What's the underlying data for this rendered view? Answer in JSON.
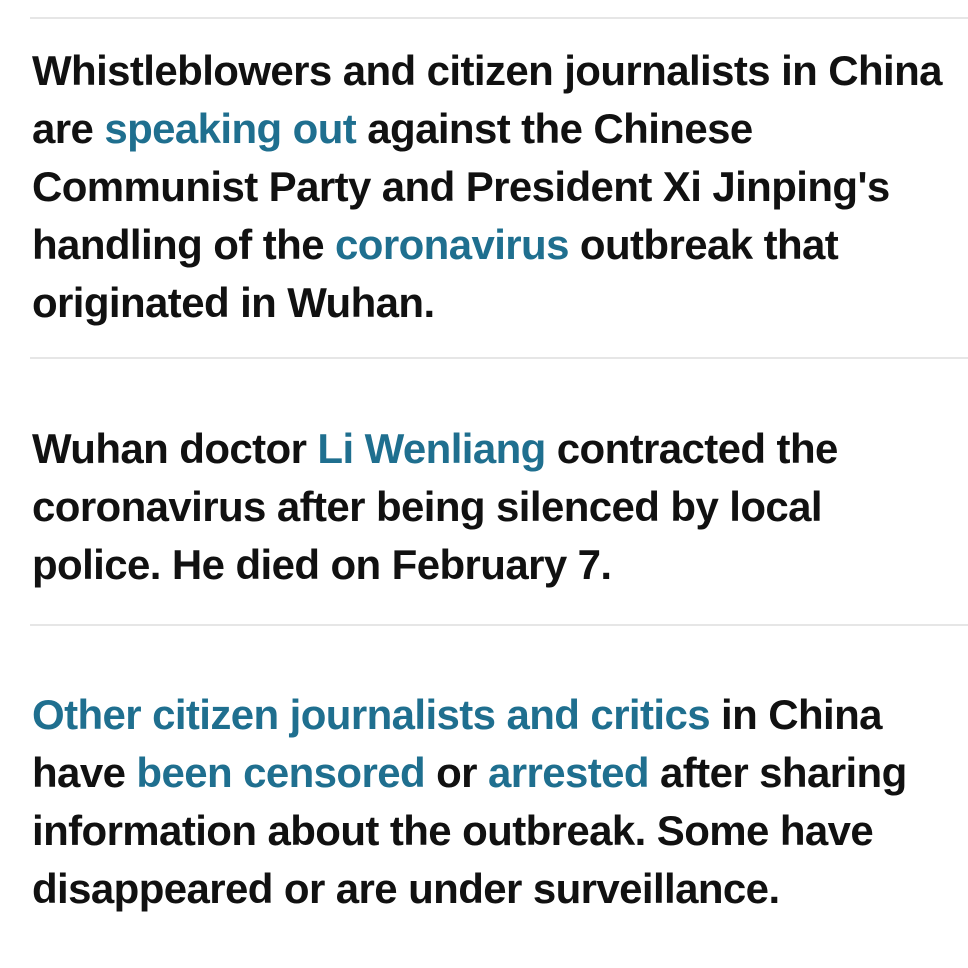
{
  "colors": {
    "link": "#1f6f8f",
    "text": "#111111",
    "divider": "#e6e6e6"
  },
  "bullets": [
    {
      "parts": [
        {
          "text": "Whistleblowers and citizen journalists in China are ",
          "link": false
        },
        {
          "text": "speaking out",
          "link": true
        },
        {
          "text": " against the Chinese Communist Party and President Xi Jinping's handling of the ",
          "link": false
        },
        {
          "text": "coronavirus",
          "link": true
        },
        {
          "text": " outbreak that originated in Wuhan.",
          "link": false
        }
      ]
    },
    {
      "parts": [
        {
          "text": "Wuhan doctor ",
          "link": false
        },
        {
          "text": "Li Wenliang",
          "link": true
        },
        {
          "text": " contracted the coronavirus after being silenced by local police. He died on February 7.",
          "link": false
        }
      ]
    },
    {
      "parts": [
        {
          "text": "Other citizen journalists and critics",
          "link": true
        },
        {
          "text": " in China have ",
          "link": false
        },
        {
          "text": "been censored",
          "link": true
        },
        {
          "text": " or ",
          "link": false
        },
        {
          "text": "arrested",
          "link": true
        },
        {
          "text": " after sharing information about the outbreak. Some have disappeared or are under surveillance.",
          "link": false
        }
      ]
    }
  ]
}
